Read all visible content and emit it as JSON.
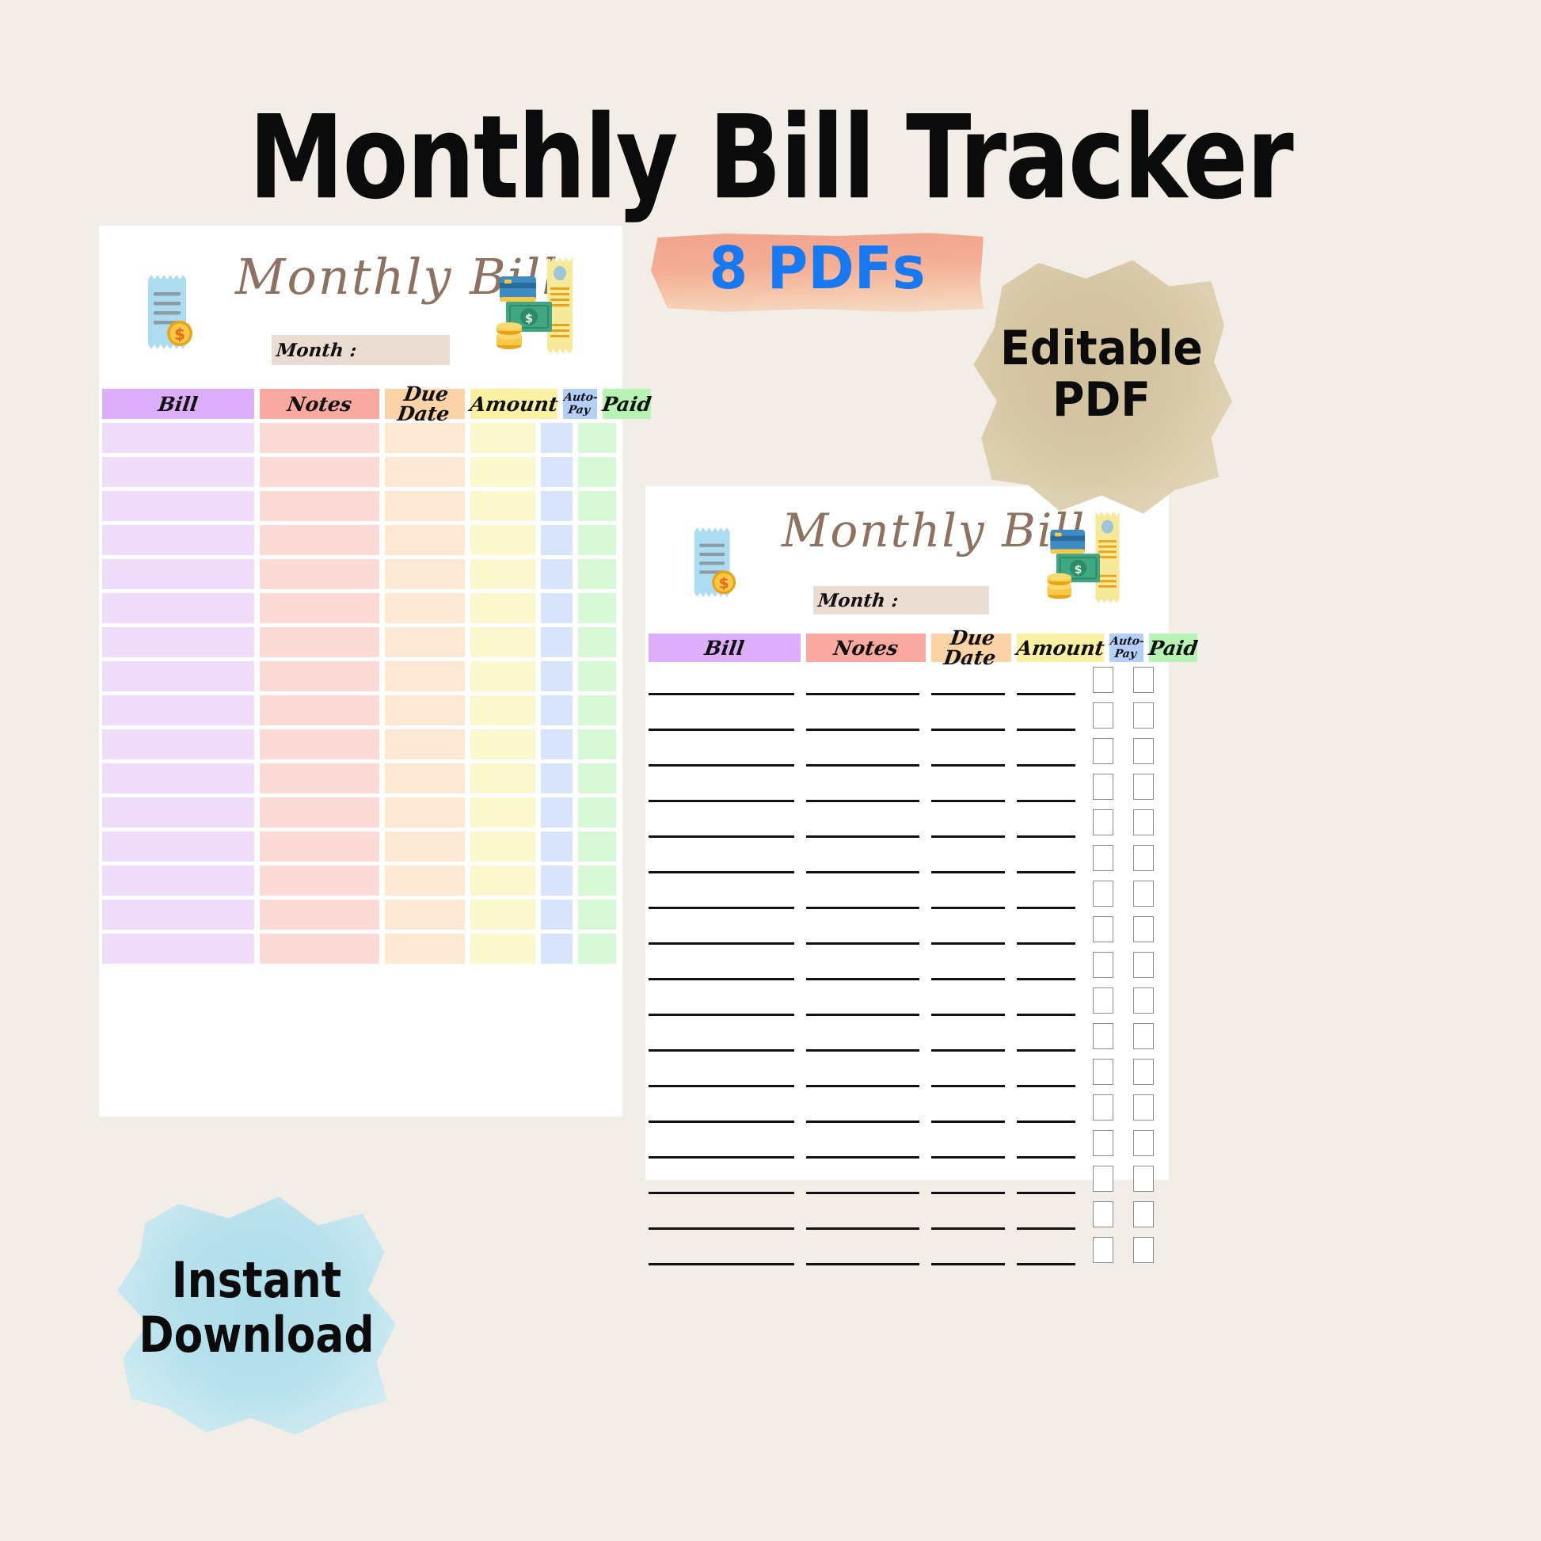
{
  "page": {
    "background_color": "#F2EDE7",
    "title": "Monthly Bill Tracker"
  },
  "badges": {
    "pdfs": {
      "label": "8 PDFs",
      "text_color": "#1878F0",
      "wash_color": "#F29E86"
    },
    "editable": {
      "line1": "Editable",
      "line2": "PDF",
      "text_color": "#0B0B0B",
      "blob_color": "#D5C5A1"
    },
    "instant": {
      "line1": "Instant",
      "line2": "Download",
      "text_color": "#0B0B0B",
      "splash_color": "#B6E2EE"
    }
  },
  "columns": [
    {
      "key": "bill",
      "label": "Bill",
      "header_color": "#DDAEFB",
      "row_color": "#F0DDFB"
    },
    {
      "key": "notes",
      "label": "Notes",
      "header_color": "#F9A9A0",
      "row_color": "#FCDAD6"
    },
    {
      "key": "due",
      "label": "Due Date",
      "header_color": "#FBD3A6",
      "row_color": "#FDE9D3"
    },
    {
      "key": "amt",
      "label": "Amount",
      "header_color": "#FAF0A3",
      "row_color": "#FCF8CE"
    },
    {
      "key": "auto",
      "label": "Auto-Pay",
      "header_color": "#B6CFF8",
      "row_color": "#D8E4FB"
    },
    {
      "key": "paid",
      "label": "Paid",
      "header_color": "#B6F3B4",
      "row_color": "#D8F9D6"
    }
  ],
  "auto_pay_header_lines": [
    "Auto-",
    "Pay"
  ],
  "sheets": [
    {
      "id": "sheet-1",
      "script_title": "Monthly Bill",
      "month_label": "Month :",
      "month_value": "",
      "row_style": "blocks",
      "row_count": 16,
      "icons": {
        "left": "receipt-coin-icon",
        "right": "cash-card-receipt-icon"
      }
    },
    {
      "id": "sheet-2",
      "script_title": "Monthly Bill",
      "month_label": "Month :",
      "month_value": "",
      "row_style": "lines",
      "row_count": 17,
      "icons": {
        "left": "receipt-coin-icon",
        "right": "cash-card-receipt-icon"
      }
    }
  ]
}
